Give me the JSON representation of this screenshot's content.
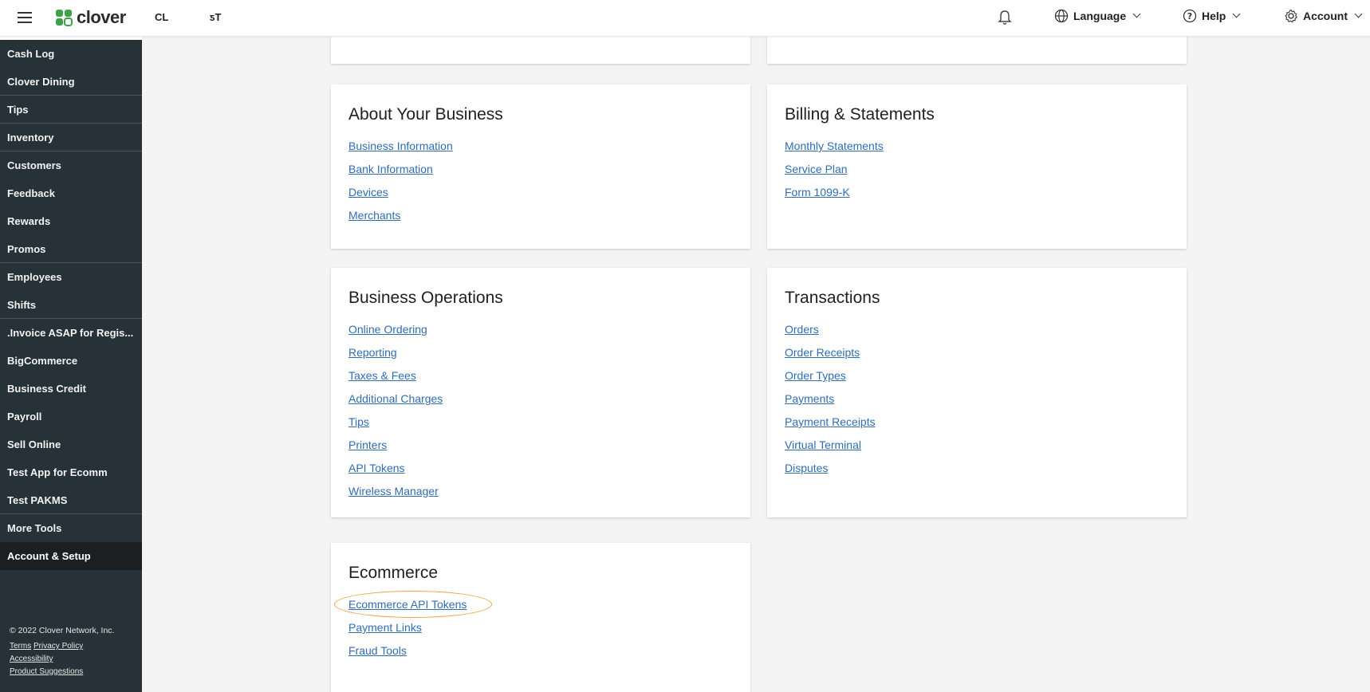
{
  "header": {
    "brand": "clover",
    "merchant_a": "CL",
    "merchant_b": "ƽT",
    "language_label": "Language",
    "help_label": "Help",
    "account_label": "Account"
  },
  "sidebar": {
    "items": [
      "Cash Log",
      "Clover Dining",
      "Tips",
      "Inventory",
      "Customers",
      "Feedback",
      "Rewards",
      "Promos",
      "Employees",
      "Shifts",
      ".Invoice ASAP for Regis...",
      "BigCommerce",
      "Business Credit",
      "Payroll",
      "Sell Online",
      "Test App for Ecomm",
      "Test PAKMS",
      "More Tools",
      "Account & Setup"
    ],
    "active": "Account & Setup",
    "footer": {
      "copyright": "© 2022 Clover Network, Inc.",
      "terms": "Terms",
      "privacy": "Privacy Policy",
      "accessibility": "Accessibility",
      "suggestions": "Product Suggestions"
    }
  },
  "cards": {
    "about": {
      "title": "About Your Business",
      "links": [
        "Business Information",
        "Bank Information",
        "Devices",
        "Merchants"
      ]
    },
    "billing": {
      "title": "Billing & Statements",
      "links": [
        "Monthly Statements",
        "Service Plan",
        "Form 1099-K"
      ]
    },
    "operations": {
      "title": "Business Operations",
      "links": [
        "Online Ordering",
        "Reporting",
        "Taxes & Fees",
        "Additional Charges",
        "Tips",
        "Printers",
        "API Tokens",
        "Wireless Manager"
      ]
    },
    "transactions": {
      "title": "Transactions",
      "links": [
        "Orders",
        "Order Receipts",
        "Order Types",
        "Payments",
        "Payment Receipts",
        "Virtual Terminal",
        "Disputes"
      ]
    },
    "ecommerce": {
      "title": "Ecommerce",
      "links": [
        "Ecommerce API Tokens",
        "Payment Links",
        "Fraud Tools"
      ]
    }
  },
  "colors": {
    "sidebar_bg": "#263238",
    "link": "#2f6db5",
    "highlight": "#f0a040",
    "brand_green": "#3ca14b"
  }
}
